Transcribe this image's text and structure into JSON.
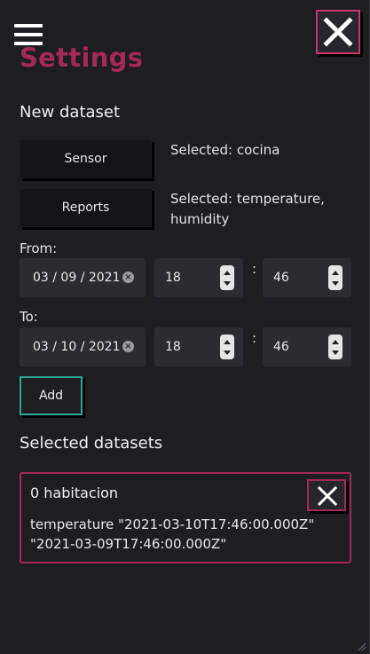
{
  "header": {
    "menu_icon": "hamburger-menu-icon",
    "close_icon": "close-x-icon",
    "title": "Settings"
  },
  "new_dataset": {
    "heading": "New dataset",
    "sensor_button": "Sensor",
    "sensor_selected": "Selected: cocina",
    "reports_button": "Reports",
    "reports_selected_line1": "Selected: temperature,",
    "reports_selected_line2": "humidity",
    "from_label": "From:",
    "from_date": "03 / 09 / 2021",
    "from_hour": "18",
    "from_minute": "46",
    "to_label": "To:",
    "to_date": "03 / 10 / 2021",
    "to_hour": "18",
    "to_minute": "46",
    "time_separator": ":",
    "add_button": "Add"
  },
  "selected_datasets": {
    "heading": "Selected datasets",
    "items": [
      {
        "name": "0 habitacion",
        "detail_line1": "temperature \"2021-03-10T17:46:00.000Z\"",
        "detail_line2": "\"2021-03-09T17:46:00.000Z\""
      }
    ]
  },
  "colors": {
    "accent": "#a4285a",
    "accent_border": "#c7356f",
    "add_border": "#2aa896",
    "background": "#1e1d22"
  }
}
